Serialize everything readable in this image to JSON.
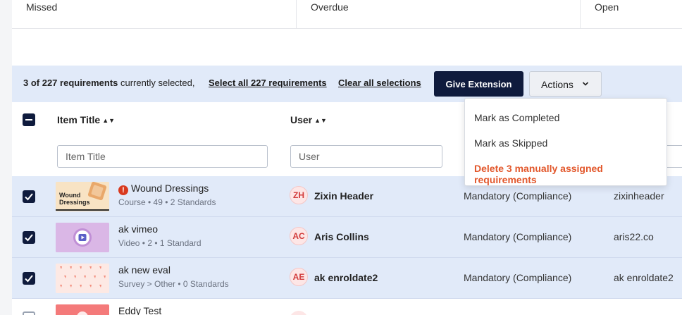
{
  "stats": {
    "missed": "Missed",
    "overdue": "Overdue",
    "open": "Open"
  },
  "selection": {
    "count_bold": "3 of 227 requirements",
    "count_rest": " currently selected,",
    "select_all": "Select all 227 requirements",
    "clear_all": "Clear all selections",
    "give_extension": "Give Extension",
    "actions": "Actions"
  },
  "actions_menu": {
    "mark_completed": "Mark as Completed",
    "mark_skipped": "Mark as Skipped",
    "delete_manual": "Delete 3 manually assigned requirements"
  },
  "table": {
    "headers": {
      "item_title": "Item Title",
      "user": "User"
    },
    "filters": {
      "item_title_placeholder": "Item Title",
      "user_placeholder": "User"
    },
    "rows": [
      {
        "title": "Wound Dressings",
        "meta": "Course  •  49  •  2 Standards",
        "initials": "ZH",
        "user": "Zixin Header",
        "type": "Mandatory (Compliance)",
        "username": "zixinheader",
        "thumb_text": "Wound Dressings"
      },
      {
        "title": "ak vimeo",
        "meta": "Video  •  2  •  1 Standard",
        "initials": "AC",
        "user": "Aris Collins",
        "type": "Mandatory (Compliance)",
        "username": "aris22.co"
      },
      {
        "title": "ak new eval",
        "meta": "Survey > Other  •  0 Standards",
        "initials": "AE",
        "user": "ak enroldate2",
        "type": "Mandatory (Compliance)",
        "username": "ak enroldate2"
      },
      {
        "title": "Eddy Test"
      }
    ]
  },
  "colors": {
    "accent_navy": "#0f1b3d",
    "selected_row": "#e1eaf9",
    "danger": "#e2572b"
  }
}
